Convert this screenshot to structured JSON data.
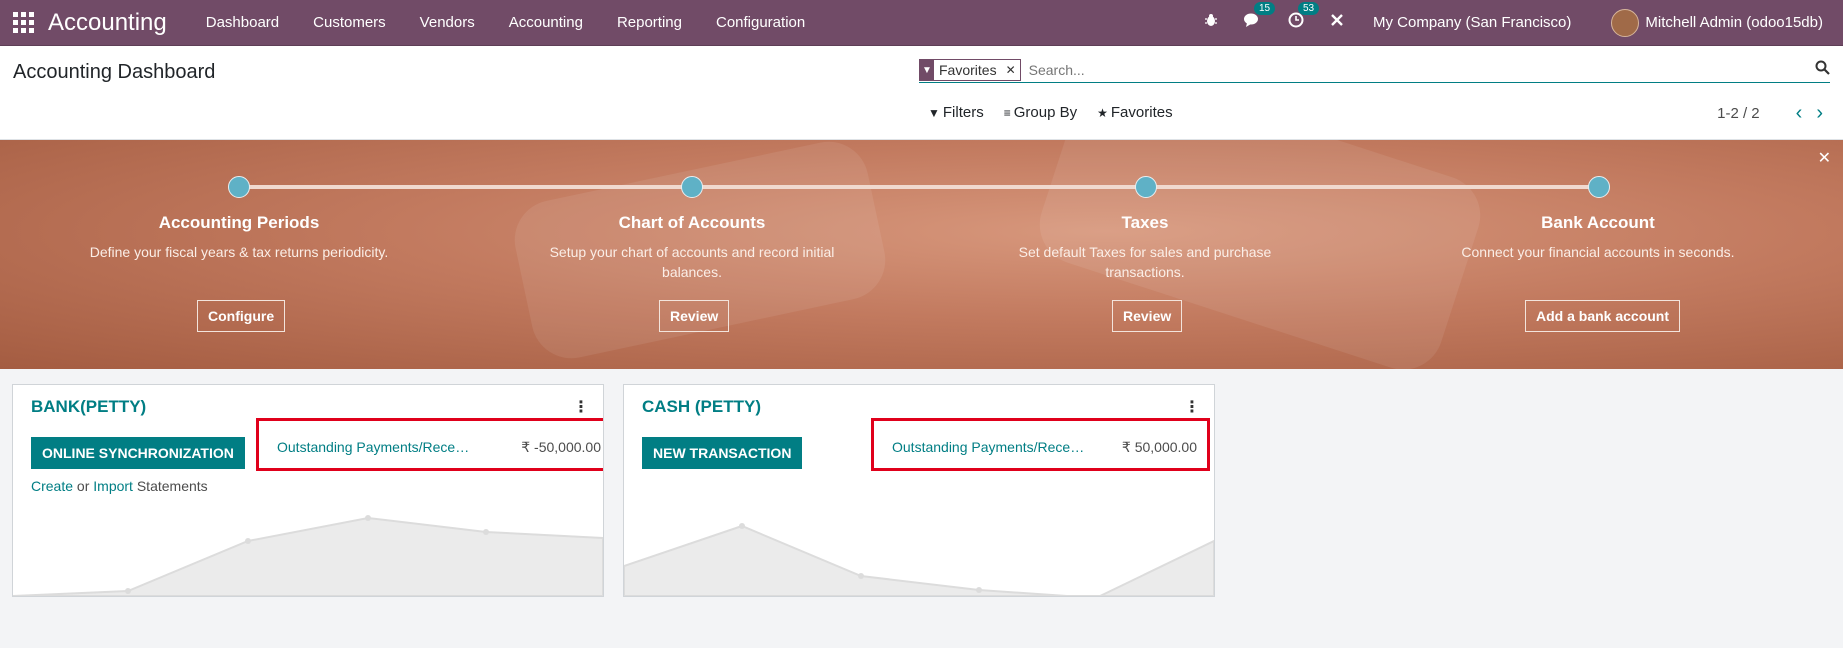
{
  "navbar": {
    "brand": "Accounting",
    "menu": [
      "Dashboard",
      "Customers",
      "Vendors",
      "Accounting",
      "Reporting",
      "Configuration"
    ],
    "messages_count": "15",
    "activities_count": "53",
    "company": "My Company (San Francisco)",
    "user": "Mitchell Admin (odoo15db)"
  },
  "control": {
    "title": "Accounting Dashboard",
    "facet": "Favorites",
    "search_placeholder": "Search...",
    "filters": "Filters",
    "group_by": "Group By",
    "favorites": "Favorites",
    "pager": "1-2 / 2"
  },
  "banner": {
    "steps": [
      {
        "title": "Accounting Periods",
        "desc": "Define your fiscal years & tax returns periodicity.",
        "button": "Configure"
      },
      {
        "title": "Chart of Accounts",
        "desc": "Setup your chart of accounts and record initial balances.",
        "button": "Review"
      },
      {
        "title": "Taxes",
        "desc": "Set default Taxes for sales and purchase transactions.",
        "button": "Review"
      },
      {
        "title": "Bank Account",
        "desc": "Connect your financial accounts in seconds.",
        "button": "Add a bank account"
      }
    ]
  },
  "journals": [
    {
      "name": "BANK(PETTY)",
      "button": "ONLINE SYNCHRONIZATION",
      "outstanding_label": "Outstanding Payments/Receipts",
      "outstanding_amount": "₹ -50,000.00",
      "create": "Create",
      "or": "or",
      "import": "Import",
      "statements": "Statements"
    },
    {
      "name": "CASH (PETTY)",
      "button": "NEW TRANSACTION",
      "outstanding_label": "Outstanding Payments/Receipts",
      "outstanding_amount": "₹ 50,000.00"
    }
  ],
  "colors": {
    "brand": "#714b67",
    "accent": "#017e84",
    "highlight": "#e0001b"
  }
}
